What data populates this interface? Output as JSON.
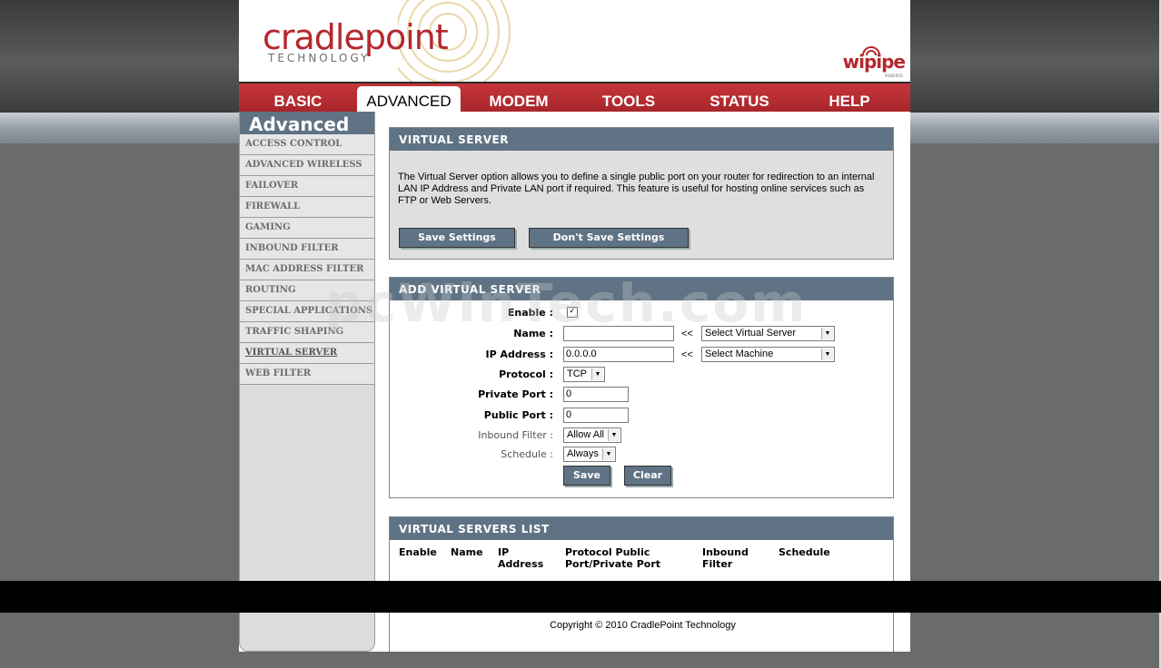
{
  "brand": {
    "logo_main": "cradlepoint",
    "logo_sub": "TECHNOLOGY",
    "partner_logo": "wipipe",
    "partner_sub": "POWERED"
  },
  "nav": {
    "tabs": [
      {
        "label": "BASIC"
      },
      {
        "label": "ADVANCED"
      },
      {
        "label": "MODEM"
      },
      {
        "label": "TOOLS"
      },
      {
        "label": "STATUS"
      },
      {
        "label": "HELP"
      }
    ],
    "active": "ADVANCED"
  },
  "sidebar": {
    "title": "Advanced",
    "items": [
      {
        "label": "ACCESS CONTROL"
      },
      {
        "label": "ADVANCED WIRELESS"
      },
      {
        "label": "FAILOVER"
      },
      {
        "label": "FIREWALL"
      },
      {
        "label": "GAMING"
      },
      {
        "label": "INBOUND FILTER"
      },
      {
        "label": "MAC ADDRESS FILTER"
      },
      {
        "label": "ROUTING"
      },
      {
        "label": "SPECIAL APPLICATIONS"
      },
      {
        "label": "TRAFFIC SHAPING"
      },
      {
        "label": "VIRTUAL SERVER"
      },
      {
        "label": "WEB FILTER"
      }
    ],
    "active": "VIRTUAL SERVER"
  },
  "virtual_server": {
    "title": "VIRTUAL SERVER",
    "description": "The Virtual Server option allows you to define a single public port on your router for redirection to an internal LAN IP Address and Private LAN port if required. This feature is useful for hosting online services such as FTP or Web Servers.",
    "save_label": "Save Settings",
    "dont_save_label": "Don't Save Settings"
  },
  "add_server": {
    "title": "ADD VIRTUAL SERVER",
    "enable_label": "Enable :",
    "enable_checked": true,
    "checkmark": "✓",
    "name_label": "Name :",
    "name_value": "",
    "arrows": "<<",
    "name_select": "Select Virtual Server",
    "ip_label": "IP Address :",
    "ip_value": "0.0.0.0",
    "ip_select": "Select Machine",
    "protocol_label": "Protocol :",
    "protocol_value": "TCP",
    "private_port_label": "Private Port :",
    "private_port_value": "0",
    "public_port_label": "Public Port :",
    "public_port_value": "0",
    "inbound_label": "Inbound Filter :",
    "inbound_value": "Allow All",
    "schedule_label": "Schedule :",
    "schedule_value": "Always",
    "save_label": "Save",
    "clear_label": "Clear"
  },
  "servers_list": {
    "title": "VIRTUAL SERVERS LIST",
    "columns": [
      "Enable",
      "Name",
      "IP Address",
      "Protocol Public Port/Private Port",
      "Inbound Filter",
      "Schedule"
    ]
  },
  "footer": {
    "copyright": "Copyright © 2010 CradlePoint Technology"
  },
  "watermark": "pcWinTech.com",
  "colors": {
    "brand_red": "#b5282e",
    "panel_blue": "#5f7384"
  }
}
